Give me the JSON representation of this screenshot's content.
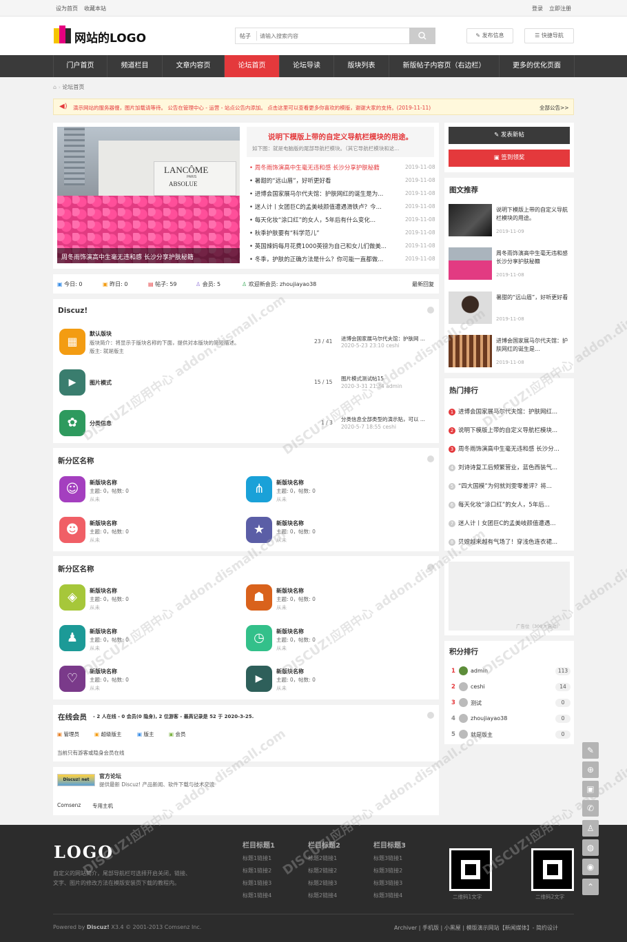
{
  "topbar": {
    "set_home": "设为首页",
    "bookmark": "收藏本站",
    "login": "登录",
    "register": "立即注册"
  },
  "header": {
    "logo_text": "网站的LOGO",
    "search_type": "帖子",
    "search_placeholder": "请输入搜索内容",
    "publish": "发布信息",
    "quick_nav": "快捷导航"
  },
  "nav": [
    "门户首页",
    "频道栏目",
    "文章内容页",
    "论坛首页",
    "论坛导读",
    "版块列表",
    "新版帖子内容页（右边栏）",
    "更多的优化页面"
  ],
  "breadcrumb": "论坛首页",
  "notice": {
    "text": "演示网站的服务器慢，图片加载请等待。 公告在管理中心 - 运营 - 站点公告内添加。 点击这里可以查看更多你喜欢的模版，谢谢大家的支持。(2019-11-11)",
    "all": "全部公告>>"
  },
  "slide": {
    "caption": "周冬雨饰演高中生毫无违和感 长沙分享护肤秘籍",
    "brand": "LANCÔME",
    "brand_sub": "ABSOLUE",
    "brand_small": "PARIS"
  },
  "headline": {
    "title": "说明下模版上带的自定义导航栏模块的用途。",
    "desc": "如下图：就是电脑版的尾部导航栏模块。（其它导航栏模块和这..."
  },
  "news": [
    {
      "t": "周冬雨饰演高中生毫无违和感 长沙分享护肤秘籍",
      "d": "2019-11-08"
    },
    {
      "t": "暑甜的“远山眉”，好听更好看",
      "d": "2019-11-08"
    },
    {
      "t": "进博会国家展马尔代夫馆：护肤网红的诞生是为...",
      "d": "2019-11-08"
    },
    {
      "t": "迷人计丨女团巨C的孟美岐颜值遭遇滑铁卢？今...",
      "d": "2019-11-08"
    },
    {
      "t": "每天化妆“涂口红”的女人，5年后有什么变化...",
      "d": "2019-11-08"
    },
    {
      "t": "秋季护肤要有“科学范儿”",
      "d": "2019-11-08"
    },
    {
      "t": "英国辣妈每月花费1000英镑为自己和女儿们做美...",
      "d": "2019-11-08"
    },
    {
      "t": "冬季，护肤的正确方法是什么？你可能一直都做...",
      "d": "2019-11-08"
    }
  ],
  "stats": {
    "today": "今日: 0",
    "yesterday": "昨日: 0",
    "posts": "帖子: 59",
    "members": "会员: 5",
    "welcome": "欢迎新会员: zhoujiayao38",
    "latest": "最新回复"
  },
  "discuz": {
    "title": "Discuz!",
    "forums": [
      {
        "name": "默认版块",
        "desc": "版块简介：将显示于版块名称的下面，提供对本版块的简短描述。",
        "mod": "版主: 就是版主",
        "count": "23 / 41",
        "last": "进博会国家展马尔代夫馆：护肤网 ...",
        "last_time": "2020-5-23 23:10 ceshi",
        "color": "#f39c12"
      },
      {
        "name": "图片模式",
        "desc": "",
        "mod": "",
        "count": "15 / 15",
        "last": "图片模式测试帖15",
        "last_time": "2020-3-31 21:34 admin",
        "color": "#3a7d6e"
      },
      {
        "name": "分类信息",
        "desc": "",
        "mod": "",
        "count": "1 / 3",
        "last": "分类信息全部类型的演示贴，可以 ...",
        "last_time": "2020-5-7 18:55 ceshi",
        "color": "#2e9a5e"
      }
    ]
  },
  "group1": {
    "title": "新分区名称",
    "forums": [
      {
        "name": "新版块名称",
        "stat": "主题: 0，帖数: 0",
        "last": "从未",
        "color": "#a43fbf",
        "icon": "☺"
      },
      {
        "name": "新版块名称",
        "stat": "主题: 0，帖数: 0",
        "last": "从未",
        "color": "#1aa1d8",
        "icon": "⋔"
      },
      {
        "name": "新版块名称",
        "stat": "主题: 0，帖数: 0",
        "last": "从未",
        "color": "#f05f66",
        "icon": "☻"
      },
      {
        "name": "新版块名称",
        "stat": "主题: 0，帖数: 0",
        "last": "从未",
        "color": "#5b5ea6",
        "icon": "★"
      }
    ]
  },
  "group2": {
    "title": "新分区名称",
    "forums": [
      {
        "name": "新版块名称",
        "stat": "主题: 0，帖数: 0",
        "last": "从未",
        "color": "#a6c73a",
        "icon": "◈"
      },
      {
        "name": "新版块名称",
        "stat": "主题: 0，帖数: 0",
        "last": "从未",
        "color": "#d9621c",
        "icon": "☗"
      },
      {
        "name": "新版块名称",
        "stat": "主题: 0，帖数: 0",
        "last": "从未",
        "color": "#1c9a97",
        "icon": "♟"
      },
      {
        "name": "新版块名称",
        "stat": "主题: 0，帖数: 0",
        "last": "从未",
        "color": "#33c08a",
        "icon": "◷"
      },
      {
        "name": "新版块名称",
        "stat": "主题: 0，帖数: 0",
        "last": "从未",
        "color": "#7a3a8a",
        "icon": "♡"
      },
      {
        "name": "新版块名称",
        "stat": "主题: 0，帖数: 0",
        "last": "从未",
        "color": "#2e5f5a",
        "icon": "▶"
      }
    ]
  },
  "online": {
    "title": "在线会员",
    "info": "- 2 人在线 - 0 会员(0 隐身), 2 位游客 - 最高记录是 52 于 2020-3-25.",
    "legend": [
      "管理员",
      "超级版主",
      "版主",
      "会员"
    ],
    "empty": "当前只有游客或隐身会员在线"
  },
  "links": {
    "name": "官方论坛",
    "desc": "提供最新 Discuz! 产品新闻、软件下载与技术交流",
    "logo": "Discuz! net",
    "items": [
      "Comsenz",
      "专用主机"
    ]
  },
  "right": {
    "new_post": "发表新帖",
    "checkin": "签到领奖",
    "pic_title": "图文推荐",
    "pics": [
      {
        "t": "说明下模版上带的自定义导航栏模块的用途。",
        "d": "2019-11-09"
      },
      {
        "t": "周冬雨饰演高中生毫无违和感 长沙分享护肤秘籍",
        "d": "2019-11-08"
      },
      {
        "t": "暑甜的“远山眉”，好听更好看",
        "d": "2019-11-08"
      },
      {
        "t": "进博会国家展马尔代夫馆：护肤网红的诞生是...",
        "d": "2019-11-08"
      }
    ],
    "hot_title": "热门排行",
    "hot": [
      "进博会国家展马尔代夫馆：护肤网红...",
      "说明下模版上带的自定义导航栏模块...",
      "周冬雨饰演高中生毫无违和感 长沙分...",
      "刘诗诗复工后频繁营业，蓝色西装气...",
      "“四大国模”为何就刘雯零差评？将...",
      "每天化妆“涂口红”的女人，5年后...",
      "迷人计丨女团巨C的孟美岐颜值遭遇...",
      "贝嫂越来越有气场了！穿浅色连衣裙..."
    ],
    "ad": "广告位（300 * 自动）",
    "score_title": "积分排行",
    "scores": [
      {
        "n": "1",
        "u": "admin",
        "v": "113"
      },
      {
        "n": "2",
        "u": "ceshi",
        "v": "14"
      },
      {
        "n": "3",
        "u": "测试",
        "v": "0"
      },
      {
        "n": "4",
        "u": "zhoujiayao38",
        "v": "0"
      },
      {
        "n": "5",
        "u": "就是版主",
        "v": "0"
      }
    ]
  },
  "footer": {
    "logo": "LOGO",
    "desc1": "自定义的网站简介，尾部导航栏可选择开启关闭，链接、",
    "desc2": "文字、图片的修改方法在模版安装页下载的教程内。",
    "cols": [
      {
        "h": "栏目标题1",
        "l": [
          "标题1链接1",
          "标题1链接2",
          "标题1链接3",
          "标题1链接4"
        ]
      },
      {
        "h": "栏目标题2",
        "l": [
          "标题2链接1",
          "标题2链接2",
          "标题2链接3",
          "标题2链接4"
        ]
      },
      {
        "h": "栏目标题3",
        "l": [
          "标题3链接1",
          "标题3链接2",
          "标题3链接3",
          "标题3链接4"
        ]
      }
    ],
    "qr1": "二维码1文字",
    "qr2": "二维码2文字",
    "powered": "Powered by",
    "discuz": "Discuz!",
    "ver": "X3.4 © 2001-2013 Comsenz Inc.",
    "right": "Archiver | 手机版 | 小黑屋 | 模版演示网站【新闻媒体】- 简约设计"
  },
  "watermark": "DISCUZ!应用中心 addon.dismall.com"
}
